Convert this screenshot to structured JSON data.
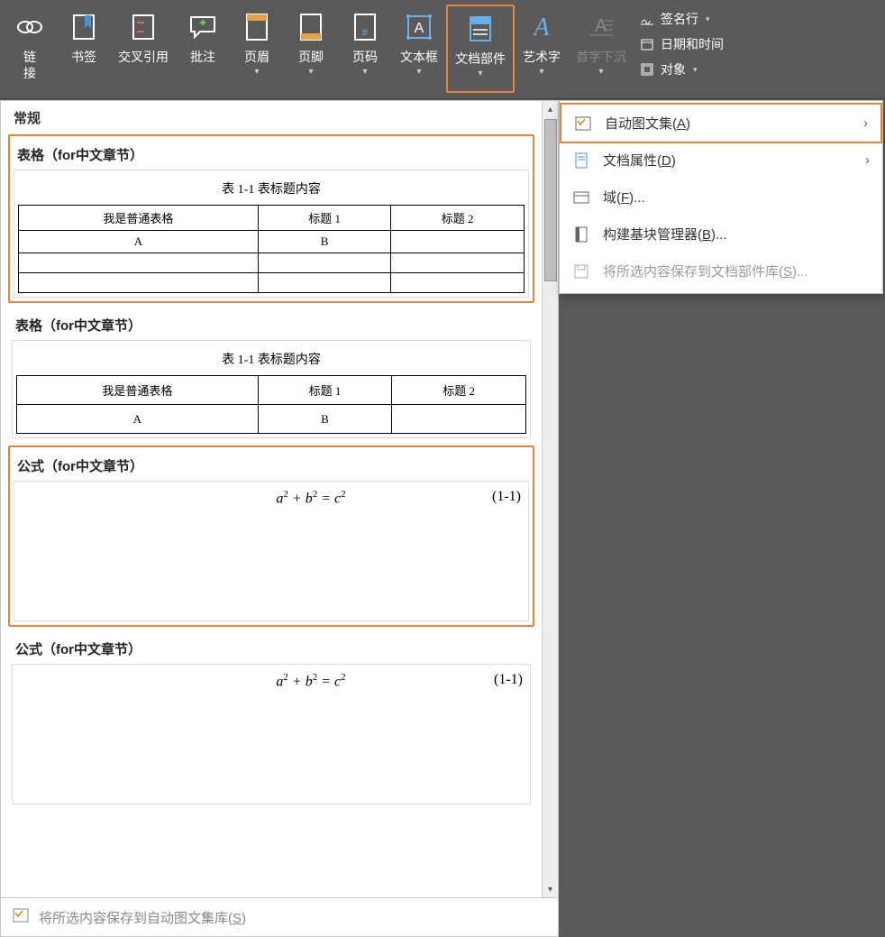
{
  "ribbon": {
    "link": "链\n接",
    "bookmark": "书签",
    "cross_reference": "交叉引用",
    "comment": "批注",
    "header": "页眉",
    "footer": "页脚",
    "page_number": "页码",
    "textbox": "文本框",
    "document_parts": "文档部件",
    "wordart": "艺术字",
    "drop_cap": "首字下沉",
    "signature_line": "签名行",
    "date_time": "日期和时间",
    "object": "对象"
  },
  "gallery": {
    "category": "常规",
    "items": [
      {
        "title": "表格（for中文章节）",
        "caption": "表 1-1 表标题内容",
        "rows": [
          [
            "我是普通表格",
            "标题 1",
            "标题 2"
          ],
          [
            "A",
            "B",
            ""
          ],
          [
            "",
            "",
            ""
          ],
          [
            "",
            "",
            ""
          ]
        ]
      },
      {
        "title": "表格（for中文章节）",
        "caption": "表 1-1 表标题内容",
        "rows": [
          [
            "我是普通表格",
            "标题 1",
            "标题 2"
          ],
          [
            "A",
            "B",
            ""
          ]
        ]
      },
      {
        "title": "公式（for中文章节）",
        "formula": "a² + b² = c²",
        "number": "(1-1)"
      },
      {
        "title": "公式（for中文章节）",
        "formula": "a² + b² = c²",
        "number": "(1-1)"
      }
    ],
    "footer": "将所选内容保存到自动图文集库(S)"
  },
  "submenu": {
    "autotext": "自动图文集(A)",
    "doc_property": "文档属性(D)",
    "field": "域(F)...",
    "building_blocks": "构建基块管理器(B)...",
    "save_to_parts": "将所选内容保存到文档部件库(S)..."
  }
}
